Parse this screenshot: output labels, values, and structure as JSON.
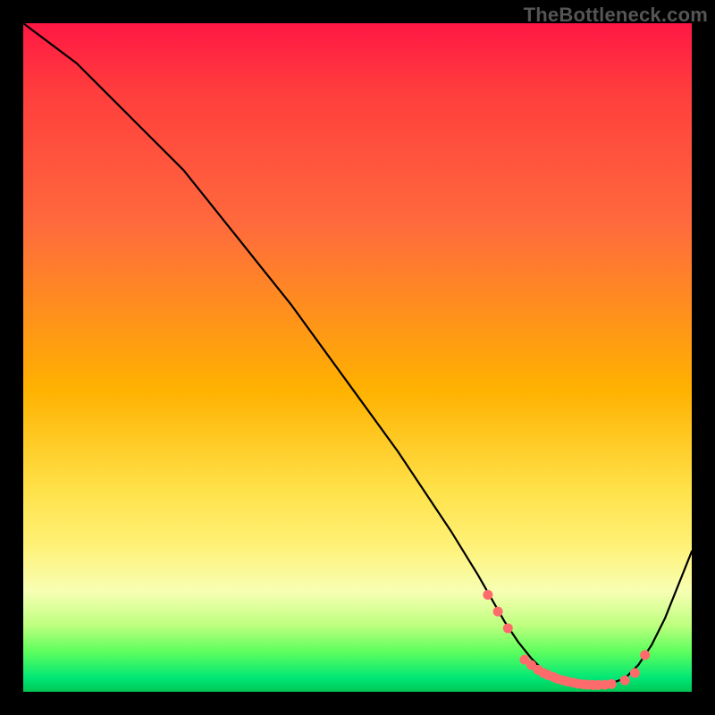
{
  "watermark": "TheBottleneck.com",
  "colors": {
    "curve": "#000000",
    "marker": "#ff6b6b",
    "frame": "#000000"
  },
  "chart_data": {
    "type": "line",
    "title": "",
    "xlabel": "",
    "ylabel": "",
    "xlim": [
      0,
      100
    ],
    "ylim": [
      0,
      100
    ],
    "grid": false,
    "series": [
      {
        "name": "bottleneck-curve",
        "x": [
          0,
          4,
          8,
          12,
          16,
          20,
          24,
          28,
          32,
          36,
          40,
          44,
          48,
          52,
          56,
          60,
          64,
          68,
          70,
          72,
          74,
          76,
          78,
          80,
          82,
          84,
          86,
          88,
          90,
          92,
          94,
          96,
          98,
          100
        ],
        "y": [
          100,
          97,
          94,
          90,
          86,
          82,
          78,
          73,
          68,
          63,
          58,
          52.5,
          47,
          41.5,
          36,
          30,
          24,
          17.5,
          14,
          10.5,
          7.5,
          5,
          3,
          1.8,
          1.2,
          1,
          1,
          1.3,
          2,
          4,
          7,
          11,
          16,
          21
        ]
      }
    ],
    "markers": {
      "name": "highlight-dots",
      "x": [
        69.5,
        71,
        72.5,
        75,
        76,
        77,
        77.8,
        78.5,
        79.3,
        80,
        80.8,
        81.5,
        82.3,
        83,
        83.8,
        84.5,
        85.3,
        86,
        87,
        88,
        90,
        91.5,
        93
      ],
      "y": [
        14.5,
        12,
        9.5,
        4.8,
        4,
        3.3,
        2.8,
        2.5,
        2.2,
        1.9,
        1.7,
        1.5,
        1.35,
        1.2,
        1.1,
        1.05,
        1.02,
        1.02,
        1.05,
        1.15,
        1.7,
        2.8,
        5.5
      ]
    }
  }
}
